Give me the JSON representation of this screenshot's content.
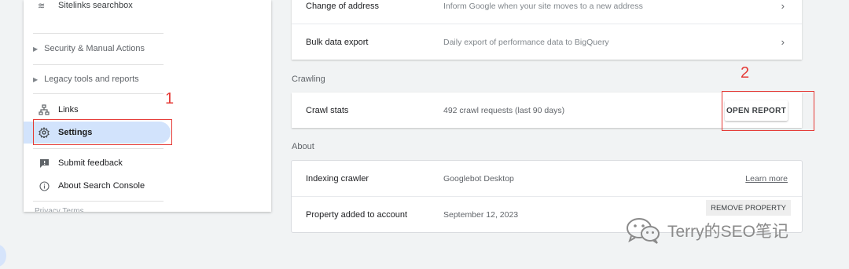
{
  "sidebar": {
    "top_item": {
      "label": "Sitelinks searchbox",
      "icon": "sitelinks-icon"
    },
    "sections": [
      {
        "label": "Security & Manual Actions",
        "icon": "caret-right-icon"
      },
      {
        "label": "Legacy tools and reports",
        "icon": "caret-right-icon"
      }
    ],
    "items": [
      {
        "label": "Links",
        "icon": "links-tree-icon"
      },
      {
        "label": "Settings",
        "icon": "gear-icon"
      },
      {
        "label": "Submit feedback",
        "icon": "feedback-icon"
      },
      {
        "label": "About Search Console",
        "icon": "info-icon"
      }
    ],
    "cut_text": "Privacy  Terms"
  },
  "annotations": [
    {
      "number": "1",
      "color": "#e53935"
    },
    {
      "number": "2",
      "color": "#e53935"
    }
  ],
  "main": {
    "general_rows": [
      {
        "name": "Change of address",
        "desc": "Inform Google when your site moves to a new address",
        "icon": "chevron-right-icon"
      },
      {
        "name": "Bulk data export",
        "desc": "Daily export of performance data to BigQuery",
        "icon": "chevron-right-icon"
      }
    ],
    "crawling": {
      "section_label": "Crawling",
      "row": {
        "name": "Crawl stats",
        "desc": "492 crawl requests (last 90 days)",
        "button": "OPEN REPORT"
      }
    },
    "about": {
      "section_label": "About",
      "rows": [
        {
          "name": "Indexing crawler",
          "value": "Googlebot Desktop",
          "action": "Learn more"
        },
        {
          "name": "Property added to account",
          "value": "September 12, 2023",
          "action": "REMOVE PROPERTY"
        }
      ]
    }
  },
  "watermark": {
    "text": "Terry的SEO笔记",
    "icon": "wechat-logo-icon"
  },
  "colors": {
    "accent_active": "#d2e3fc",
    "annotation": "#e53935",
    "background": "#f1f3f4"
  }
}
